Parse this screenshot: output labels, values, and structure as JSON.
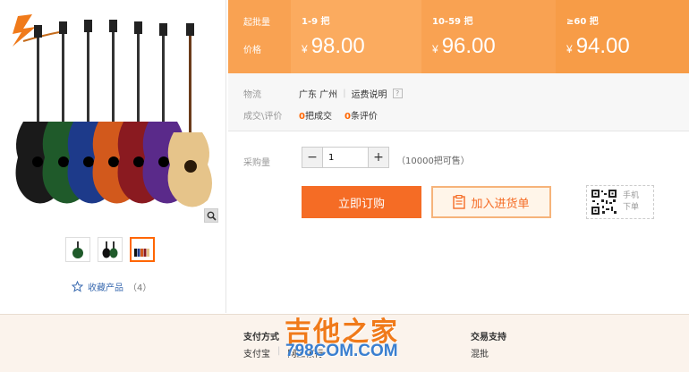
{
  "colors": {
    "accent": "#f56c25",
    "price_band": "#f9a252",
    "link": "#3b6bb0",
    "watermark_orange": "#f07a1a",
    "watermark_blue": "#3a7fd0"
  },
  "gallery": {
    "main_image": "guitar-lineup-image",
    "thumbnails": [
      "green-guitar-thumb",
      "two-guitars-thumb",
      "guitar-lineup-thumb"
    ],
    "active_thumbnail": 3,
    "favorite": {
      "label": "收藏产品",
      "count": "（4）"
    }
  },
  "pricing": {
    "qty_label": "起批量",
    "price_label": "价格",
    "tiers": [
      {
        "qty": "1-9 把",
        "currency": "¥",
        "price": "98.00"
      },
      {
        "qty": "10-59 把",
        "currency": "¥",
        "price": "96.00"
      },
      {
        "qty": "≥60 把",
        "currency": "¥",
        "price": "94.00"
      }
    ]
  },
  "info": {
    "logistics_label": "物流",
    "location": "广东 广州",
    "shipping_link": "运费说明",
    "help_icon": "?",
    "deals_label": "成交\\评价",
    "deals_count": "0",
    "deals_text": "把成交",
    "reviews_count": "0",
    "reviews_text": "条评价"
  },
  "purchase": {
    "qty_label": "采购量",
    "minus": "−",
    "plus": "+",
    "quantity": "1",
    "stock": "（10000把可售）",
    "buy_now": "立即订购",
    "add_cart": "加入进货单",
    "mobile_line1": "手机",
    "mobile_line2": "下单"
  },
  "footer": {
    "payment_title": "支付方式",
    "payment_methods": [
      "支付宝",
      "网上银行"
    ],
    "trade_title": "交易支持",
    "trade_item": "混批",
    "watermark_cn": "吉他之家",
    "watermark_url": "798COM.COM"
  }
}
